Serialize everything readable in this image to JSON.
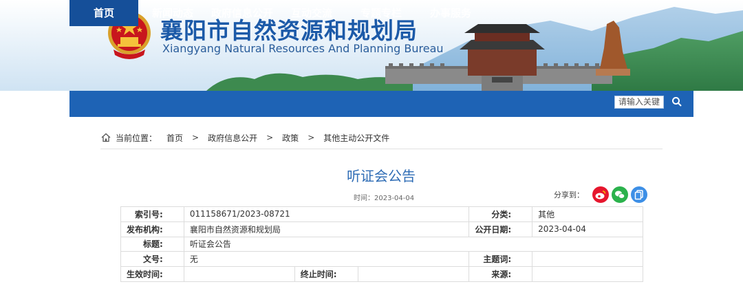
{
  "header": {
    "title_cn": "襄阳市自然资源和规划局",
    "title_en": "Xiangyang Natural Resources And Planning Bureau"
  },
  "nav": {
    "items": [
      {
        "label": "首页",
        "active": true
      },
      {
        "label": "新闻动态"
      },
      {
        "label": "政府信息公开"
      },
      {
        "label": "互动交流"
      },
      {
        "label": "专题专栏"
      },
      {
        "label": "办事服务"
      }
    ],
    "search_placeholder": "请输入关键",
    "search_icon": "search-icon"
  },
  "breadcrumb": {
    "prefix": "当前位置：",
    "items": [
      "首页",
      "政府信息公开",
      "政策",
      "其他主动公开文件"
    ],
    "separator": ">"
  },
  "article": {
    "title": "听证会公告",
    "time_label": "时间：2023-04-04"
  },
  "share": {
    "label": "分享到：",
    "icons": [
      {
        "name": "weibo-icon",
        "color": "#e6162d"
      },
      {
        "name": "wechat-icon",
        "color": "#2bb24c"
      },
      {
        "name": "copy-icon",
        "color": "#3d8fe6"
      }
    ]
  },
  "meta": {
    "index_label": "索引号:",
    "index_value": "011158671/2023-08721",
    "category_label": "分类:",
    "category_value": "其他",
    "publisher_label": "发布机构:",
    "publisher_value": "襄阳市自然资源和规划局",
    "pubdate_label": "公开日期:",
    "pubdate_value": "2023-04-04",
    "title_label": "标题:",
    "title_value": "听证会公告",
    "docno_label": "文号:",
    "docno_value": "无",
    "subject_label": "主题词:",
    "subject_value": "",
    "effective_label": "生效时间:",
    "effective_value": "",
    "end_label": "终止时间:",
    "end_value": "",
    "source_label": "来源:",
    "source_value": ""
  },
  "colors": {
    "nav_bg": "#1e63b5",
    "nav_active": "#154f99",
    "title_blue": "#1c5aa8",
    "article_title": "#2e6cb5"
  }
}
